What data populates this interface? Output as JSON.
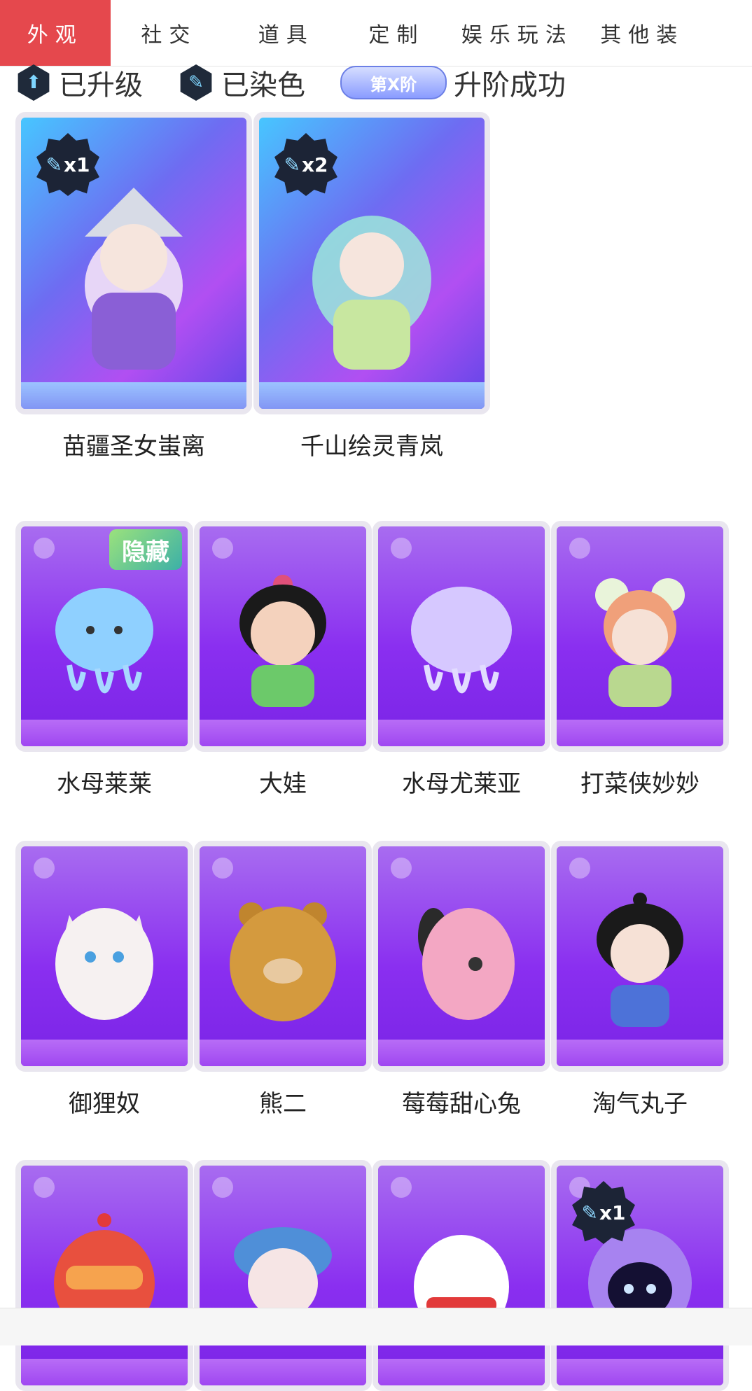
{
  "tabs": [
    {
      "label": "外观"
    },
    {
      "label": "社交"
    },
    {
      "label": "道具"
    },
    {
      "label": "定制"
    },
    {
      "label": "娱乐玩法"
    },
    {
      "label": "其他装"
    }
  ],
  "legend": {
    "upgraded": "已升级",
    "dyed": "已染色",
    "stage_pill": "第X阶",
    "stage_success": "升阶成功"
  },
  "featured": [
    {
      "name": "苗疆圣女蚩离",
      "badge": "x1"
    },
    {
      "name": "千山绘灵青岚",
      "badge": "x2"
    }
  ],
  "row2": [
    {
      "name": "水母莱莱",
      "tag": "隐藏"
    },
    {
      "name": "大娃"
    },
    {
      "name": "水母尤莱亚"
    },
    {
      "name": "打菜侠妙妙"
    }
  ],
  "row3": [
    {
      "name": "御狸奴"
    },
    {
      "name": "熊二"
    },
    {
      "name": "莓莓甜心兔"
    },
    {
      "name": "淘气丸子"
    }
  ],
  "row4_badges": {
    "last": "x1"
  },
  "colors": {
    "active_tab": "#e5484d",
    "card_purple": "#8a2ff0",
    "badge_dark": "#1c2436"
  },
  "icons": [
    "upgrade-icon",
    "dye-brush-icon",
    "stage-pill-icon"
  ]
}
